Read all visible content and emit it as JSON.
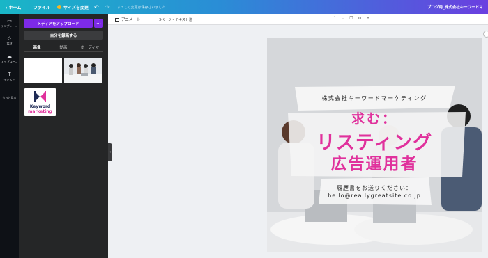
{
  "topbar": {
    "home": "‹  ホーム",
    "file": "ファイル",
    "resize": "サイズを変更",
    "undo": "↶",
    "redo": "↷",
    "save_status": "すべての変更は保存されました",
    "doc_title": "ブログ用_株式会社キーワードマ"
  },
  "rail": {
    "items": [
      {
        "label": "テンプレー...",
        "icon": "template-icon"
      },
      {
        "label": "素材",
        "icon": "elements-icon"
      },
      {
        "label": "アップロー...",
        "icon": "upload-cloud-icon"
      },
      {
        "label": "テキスト",
        "icon": "text-icon"
      },
      {
        "label": "もっと見る",
        "icon": "more-icon"
      }
    ]
  },
  "panel": {
    "upload_button": "メディアをアップロード",
    "more_button": "···",
    "record_button": "自分を録画する",
    "tabs": [
      "画像",
      "動画",
      "オーディオ"
    ],
    "logo_line1": "Keyword",
    "logo_line2": "marketing"
  },
  "workspace": {
    "animate": "アニメート",
    "page_label": "3ページ - テキスト追",
    "page_tools": [
      "⌃",
      "⌄",
      "❐",
      "⧉",
      "+"
    ]
  },
  "design": {
    "company": "株式会社キーワードマーケティング",
    "headline1": "求む：",
    "headline2": "リスティング",
    "headline3": "広告運用者",
    "send_text": "履歴書をお送りください：",
    "email": "hello@reallygreatsite.co.jp",
    "accent_color": "#e0319c"
  },
  "colors": {
    "topbar_start": "#19b6c7",
    "topbar_end": "#6a3fe0",
    "upload_button": "#7d2ae8",
    "panel_bg": "#252627",
    "rail_bg": "#0e1116"
  }
}
